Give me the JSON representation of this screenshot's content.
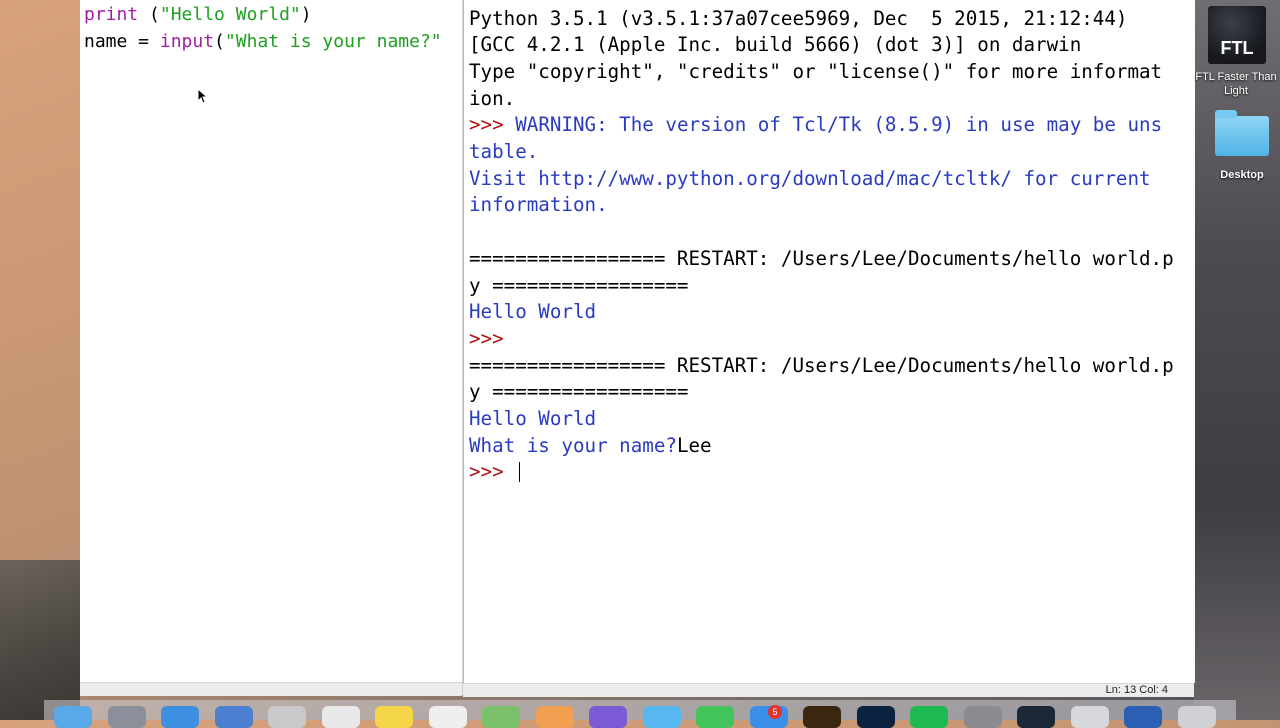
{
  "editor": {
    "lines": [
      [
        {
          "t": "print",
          "c": "kw"
        },
        {
          "t": " (",
          "c": ""
        },
        {
          "t": "\"Hello World\"",
          "c": "str"
        },
        {
          "t": ")",
          "c": ""
        }
      ],
      [
        {
          "t": "name = ",
          "c": ""
        },
        {
          "t": "input",
          "c": "kw"
        },
        {
          "t": "(",
          "c": ""
        },
        {
          "t": "\"What is your name?\"",
          "c": "str"
        }
      ]
    ]
  },
  "shell": {
    "lines": [
      [
        {
          "t": "Python 3.5.1 (v3.5.1:37a07cee5969, Dec  5 2015, 21:12:44) ",
          "c": ""
        }
      ],
      [
        {
          "t": "[GCC 4.2.1 (Apple Inc. build 5666) (dot 3)] on darwin",
          "c": ""
        }
      ],
      [
        {
          "t": "Type \"copyright\", \"credits\" or \"license()\" for more informat",
          "c": ""
        }
      ],
      [
        {
          "t": "ion.",
          "c": ""
        }
      ],
      [
        {
          "t": ">>> ",
          "c": "red"
        },
        {
          "t": "WARNING: The version of Tcl/Tk (8.5.9) in use may be uns",
          "c": "blue"
        }
      ],
      [
        {
          "t": "table.",
          "c": "blue"
        }
      ],
      [
        {
          "t": "Visit http://www.python.org/download/mac/tcltk/ for current",
          "c": "blue"
        }
      ],
      [
        {
          "t": "information.",
          "c": "blue"
        }
      ],
      [
        {
          "t": "",
          "c": ""
        }
      ],
      [
        {
          "t": "================= RESTART: /Users/Lee/Documents/hello world.p",
          "c": ""
        }
      ],
      [
        {
          "t": "y =================",
          "c": ""
        }
      ],
      [
        {
          "t": "Hello World",
          "c": "blue"
        }
      ],
      [
        {
          "t": ">>> ",
          "c": "red"
        }
      ],
      [
        {
          "t": "================= RESTART: /Users/Lee/Documents/hello world.p",
          "c": ""
        }
      ],
      [
        {
          "t": "y =================",
          "c": ""
        }
      ],
      [
        {
          "t": "Hello World",
          "c": "blue"
        }
      ],
      [
        {
          "t": "What is your name?",
          "c": "blue"
        },
        {
          "t": "Lee",
          "c": ""
        }
      ],
      [
        {
          "t": ">>> ",
          "c": "red"
        }
      ]
    ],
    "status": "Ln: 13  Col: 4"
  },
  "desktop": {
    "ftl_icon_text": "FTL",
    "ftl_label": "FTL Faster Than Light",
    "folder_label": "Desktop"
  },
  "dock": {
    "badge_count": "5",
    "items": [
      {
        "icon": "finder-icon",
        "color": "#5aa8e8"
      },
      {
        "icon": "launchpad-icon",
        "color": "#8a8f99"
      },
      {
        "icon": "safari-icon",
        "color": "#3f8fe0"
      },
      {
        "icon": "mail-icon",
        "color": "#4d7fd0"
      },
      {
        "icon": "preview-icon",
        "color": "#c9c9cc"
      },
      {
        "icon": "calendar-icon",
        "color": "#e8e8e8"
      },
      {
        "icon": "notes-icon",
        "color": "#f5d54a"
      },
      {
        "icon": "textedit-icon",
        "color": "#eeeeee"
      },
      {
        "icon": "maps-icon",
        "color": "#7bc06b"
      },
      {
        "icon": "photos-icon",
        "color": "#f0a050"
      },
      {
        "icon": "imovie-icon",
        "color": "#7b5bd6"
      },
      {
        "icon": "messages-icon",
        "color": "#58b7f0"
      },
      {
        "icon": "facetime-icon",
        "color": "#43c35b"
      },
      {
        "icon": "appstore-icon",
        "color": "#3c8fe8"
      },
      {
        "icon": "illustrator-icon",
        "color": "#3a2710"
      },
      {
        "icon": "photoshop-icon",
        "color": "#0c2340"
      },
      {
        "icon": "spotify-icon",
        "color": "#1fb954"
      },
      {
        "icon": "system-preferences-icon",
        "color": "#8c8c90"
      },
      {
        "icon": "steam-icon",
        "color": "#1b2838"
      },
      {
        "icon": "script-icon",
        "color": "#d8d8dc"
      },
      {
        "icon": "quicktime-icon",
        "color": "#2b5fb3"
      },
      {
        "icon": "trash-icon",
        "color": "#cfd1d4"
      }
    ]
  }
}
